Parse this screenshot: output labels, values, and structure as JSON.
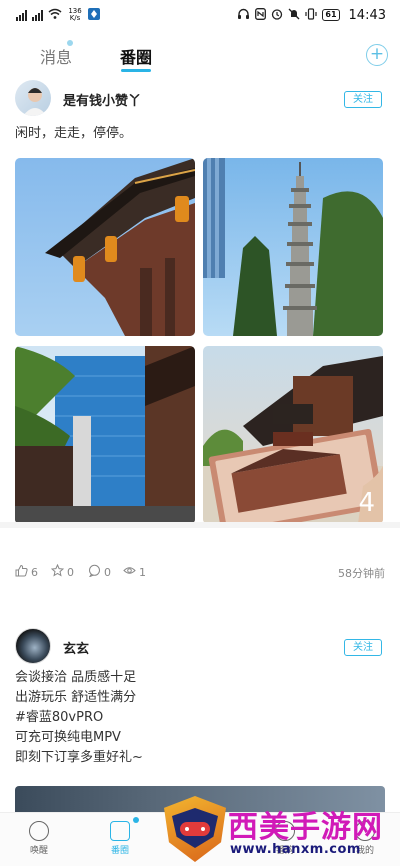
{
  "status_bar": {
    "network_speed_top": "136",
    "network_speed_bottom": "K/s",
    "battery": "61",
    "time": "14:43"
  },
  "tabs": {
    "messages": "消息",
    "circle": "番圈",
    "add_icon": "plus-circle-icon"
  },
  "posts": [
    {
      "user": "是有钱小赞丫",
      "follow": "关注",
      "text": "闲时，走走，停停。",
      "image_more_count": "4",
      "likes": "6",
      "favorites": "0",
      "comments": "0",
      "views": "1",
      "time_ago": "58分钟前"
    },
    {
      "user": "玄玄",
      "follow": "关注",
      "lines": [
        "会谈接洽 品质感十足",
        "出游玩乐 舒适性满分",
        "#睿蓝80vPRO",
        "可充可换纯电MPV",
        "即刻下订享多重好礼~"
      ]
    }
  ],
  "bottom_nav": {
    "wake": "唤醒",
    "circle": "番圈",
    "shop": "番购",
    "me": "我的"
  },
  "watermark": {
    "title": "西美手游网",
    "url": "www.hanxm.com"
  },
  "colors": {
    "accent": "#2ab4e6",
    "watermark_title": "#d11ab8"
  }
}
